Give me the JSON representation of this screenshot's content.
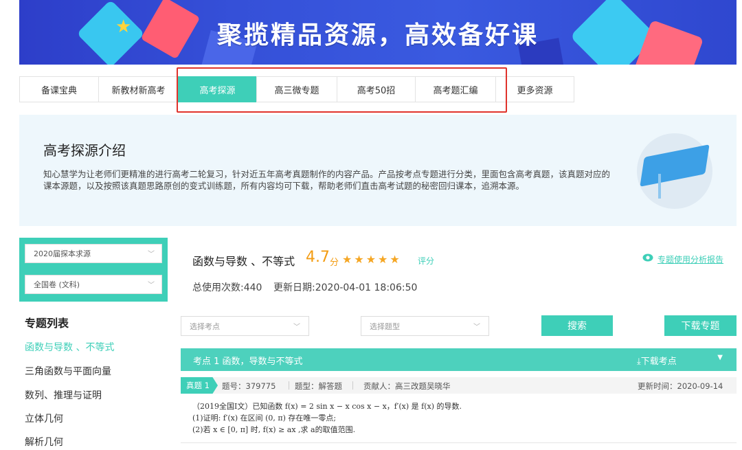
{
  "banner": {
    "title": "聚揽精品资源，高效备好课"
  },
  "tabs": [
    {
      "label": "备课宝典",
      "active": false
    },
    {
      "label": "新教材新高考",
      "active": false
    },
    {
      "label": "高考探源",
      "active": true
    },
    {
      "label": "高三微专题",
      "active": false
    },
    {
      "label": "高考50招",
      "active": false
    },
    {
      "label": "高考题汇编",
      "active": false
    },
    {
      "label": "更多资源",
      "active": false
    }
  ],
  "intro": {
    "title": "高考探源介绍",
    "text": "知心慧学为让老师们更精准的进行高考二轮复习，针对近五年高考真题制作的内容产品。产品按考点专题进行分类，里面包含高考真题，该真题对应的课本源题，以及按照该真题思路原创的变式训练题，所有内容均可下载，帮助老师们直击高考试题的秘密回归课本，追溯本源。"
  },
  "sidebar": {
    "select_year": "2020届探本求源",
    "select_region": "全国卷 (文科)",
    "list_title": "专题列表",
    "items": [
      {
        "label": "函数与导数 、不等式",
        "active": true
      },
      {
        "label": "三角函数与平面向量",
        "active": false
      },
      {
        "label": "数列、推理与证明",
        "active": false
      },
      {
        "label": "立体几何",
        "active": false
      },
      {
        "label": "解析几何",
        "active": false
      }
    ]
  },
  "topic": {
    "title": "函数与导数 、不等式",
    "score": "4.7",
    "score_unit": "分",
    "rating": 4.5,
    "stars": "★★★★★",
    "rate_label": "评分",
    "report_link": "专题使用分析报告",
    "usage": "总使用次数:440",
    "updated": "更新日期:2020-04-01 18:06:50"
  },
  "filters": {
    "kp_placeholder": "选择考点",
    "type_placeholder": "选择题型",
    "search_label": "搜索",
    "download_topic_label": "下载专题"
  },
  "knowledge_point": {
    "title": "考点 1 函数，导数与不等式",
    "download_label": "下载考点"
  },
  "question": {
    "tag": "真题 1",
    "number": "题号：379775",
    "type": "题型：解答题",
    "contributor": "贡献人：高三改题吴晓华",
    "updated": "更新时间：2020-09-14",
    "line1": "（2019全国Ⅰ文）已知函数 f(x) = 2 sin x − x cos x − x，f′(x) 是 f(x) 的导数.",
    "line2": "(1)证明: f′(x) 在区间 (0, π) 存在唯一零点;",
    "line3": "(2)若 x ∈ [0, π] 时, f(x) ≥ ax ,求 a的取值范围."
  },
  "colors": {
    "accent": "#3ecfb8",
    "star": "#f5a623",
    "score": "#f39c12",
    "highlight": "#e0322b",
    "banner": "#3550d8"
  }
}
